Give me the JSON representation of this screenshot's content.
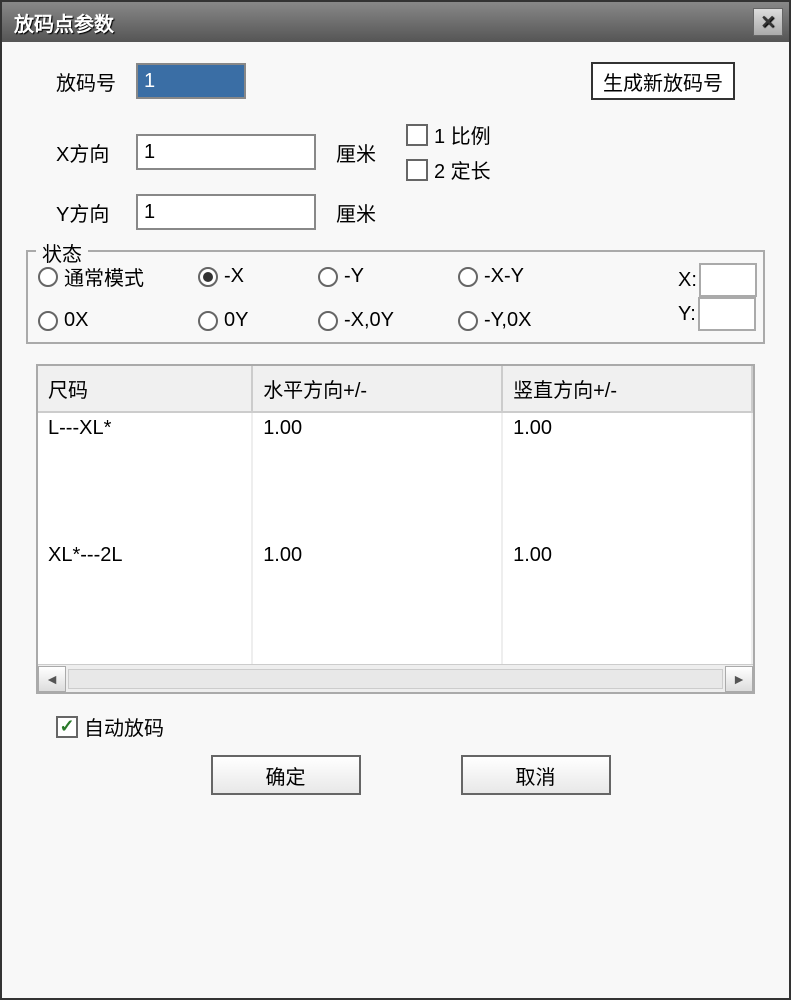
{
  "title": "放码点参数",
  "form": {
    "code_label": "放码号",
    "code_value": "1",
    "generate_btn": "生成新放码号",
    "x_label": "X方向",
    "x_value": "1",
    "y_label": "Y方向",
    "y_value": "1",
    "unit": "厘米",
    "check1": "1 比例",
    "check2": "2 定长"
  },
  "status": {
    "legend": "状态",
    "options": {
      "normal": "通常模式",
      "neg_x": "-X",
      "neg_y": "-Y",
      "neg_x_y": "-X-Y",
      "zero_x": "0X",
      "zero_y": "0Y",
      "neg_x_zero_y": "-X,0Y",
      "neg_y_zero_x": "-Y,0X"
    },
    "selected": "-X",
    "side_x_label": "X:",
    "side_y_label": "Y:"
  },
  "table": {
    "headers": [
      "尺码",
      "水平方向+/-",
      "竖直方向+/-"
    ],
    "rows": [
      {
        "size": "L---XL*",
        "h": "1.00",
        "v": "1.00"
      },
      {
        "size": "XL*---2L",
        "h": "1.00",
        "v": "1.00"
      }
    ]
  },
  "auto_label": "自动放码",
  "auto_checked": true,
  "buttons": {
    "ok": "确定",
    "cancel": "取消"
  }
}
